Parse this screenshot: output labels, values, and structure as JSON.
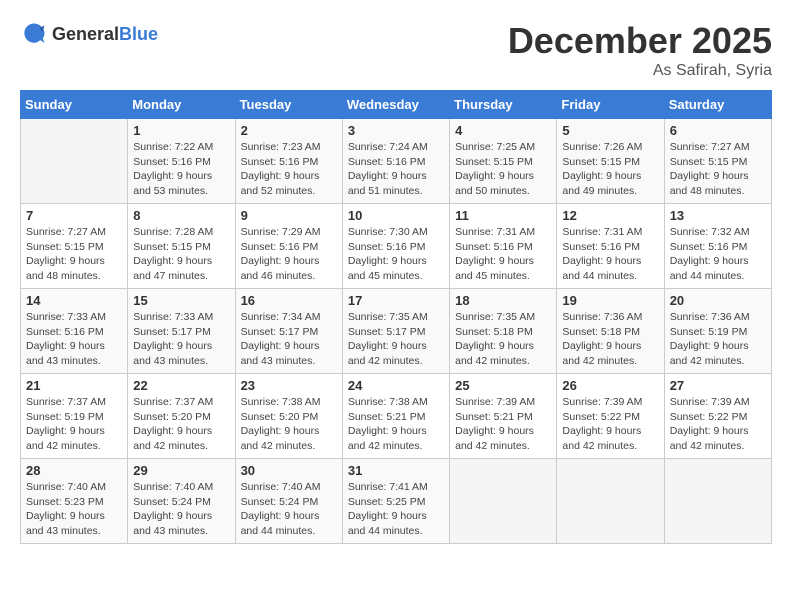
{
  "header": {
    "logo_general": "General",
    "logo_blue": "Blue",
    "month_year": "December 2025",
    "location": "As Safirah, Syria"
  },
  "days_of_week": [
    "Sunday",
    "Monday",
    "Tuesday",
    "Wednesday",
    "Thursday",
    "Friday",
    "Saturday"
  ],
  "weeks": [
    [
      {
        "day": "",
        "sunrise": "",
        "sunset": "",
        "daylight": "",
        "empty": true
      },
      {
        "day": "1",
        "sunrise": "7:22 AM",
        "sunset": "5:16 PM",
        "daylight": "9 hours and 53 minutes."
      },
      {
        "day": "2",
        "sunrise": "7:23 AM",
        "sunset": "5:16 PM",
        "daylight": "9 hours and 52 minutes."
      },
      {
        "day": "3",
        "sunrise": "7:24 AM",
        "sunset": "5:16 PM",
        "daylight": "9 hours and 51 minutes."
      },
      {
        "day": "4",
        "sunrise": "7:25 AM",
        "sunset": "5:15 PM",
        "daylight": "9 hours and 50 minutes."
      },
      {
        "day": "5",
        "sunrise": "7:26 AM",
        "sunset": "5:15 PM",
        "daylight": "9 hours and 49 minutes."
      },
      {
        "day": "6",
        "sunrise": "7:27 AM",
        "sunset": "5:15 PM",
        "daylight": "9 hours and 48 minutes."
      }
    ],
    [
      {
        "day": "7",
        "sunrise": "7:27 AM",
        "sunset": "5:15 PM",
        "daylight": "9 hours and 48 minutes."
      },
      {
        "day": "8",
        "sunrise": "7:28 AM",
        "sunset": "5:15 PM",
        "daylight": "9 hours and 47 minutes."
      },
      {
        "day": "9",
        "sunrise": "7:29 AM",
        "sunset": "5:16 PM",
        "daylight": "9 hours and 46 minutes."
      },
      {
        "day": "10",
        "sunrise": "7:30 AM",
        "sunset": "5:16 PM",
        "daylight": "9 hours and 45 minutes."
      },
      {
        "day": "11",
        "sunrise": "7:31 AM",
        "sunset": "5:16 PM",
        "daylight": "9 hours and 45 minutes."
      },
      {
        "day": "12",
        "sunrise": "7:31 AM",
        "sunset": "5:16 PM",
        "daylight": "9 hours and 44 minutes."
      },
      {
        "day": "13",
        "sunrise": "7:32 AM",
        "sunset": "5:16 PM",
        "daylight": "9 hours and 44 minutes."
      }
    ],
    [
      {
        "day": "14",
        "sunrise": "7:33 AM",
        "sunset": "5:16 PM",
        "daylight": "9 hours and 43 minutes."
      },
      {
        "day": "15",
        "sunrise": "7:33 AM",
        "sunset": "5:17 PM",
        "daylight": "9 hours and 43 minutes."
      },
      {
        "day": "16",
        "sunrise": "7:34 AM",
        "sunset": "5:17 PM",
        "daylight": "9 hours and 43 minutes."
      },
      {
        "day": "17",
        "sunrise": "7:35 AM",
        "sunset": "5:17 PM",
        "daylight": "9 hours and 42 minutes."
      },
      {
        "day": "18",
        "sunrise": "7:35 AM",
        "sunset": "5:18 PM",
        "daylight": "9 hours and 42 minutes."
      },
      {
        "day": "19",
        "sunrise": "7:36 AM",
        "sunset": "5:18 PM",
        "daylight": "9 hours and 42 minutes."
      },
      {
        "day": "20",
        "sunrise": "7:36 AM",
        "sunset": "5:19 PM",
        "daylight": "9 hours and 42 minutes."
      }
    ],
    [
      {
        "day": "21",
        "sunrise": "7:37 AM",
        "sunset": "5:19 PM",
        "daylight": "9 hours and 42 minutes."
      },
      {
        "day": "22",
        "sunrise": "7:37 AM",
        "sunset": "5:20 PM",
        "daylight": "9 hours and 42 minutes."
      },
      {
        "day": "23",
        "sunrise": "7:38 AM",
        "sunset": "5:20 PM",
        "daylight": "9 hours and 42 minutes."
      },
      {
        "day": "24",
        "sunrise": "7:38 AM",
        "sunset": "5:21 PM",
        "daylight": "9 hours and 42 minutes."
      },
      {
        "day": "25",
        "sunrise": "7:39 AM",
        "sunset": "5:21 PM",
        "daylight": "9 hours and 42 minutes."
      },
      {
        "day": "26",
        "sunrise": "7:39 AM",
        "sunset": "5:22 PM",
        "daylight": "9 hours and 42 minutes."
      },
      {
        "day": "27",
        "sunrise": "7:39 AM",
        "sunset": "5:22 PM",
        "daylight": "9 hours and 42 minutes."
      }
    ],
    [
      {
        "day": "28",
        "sunrise": "7:40 AM",
        "sunset": "5:23 PM",
        "daylight": "9 hours and 43 minutes."
      },
      {
        "day": "29",
        "sunrise": "7:40 AM",
        "sunset": "5:24 PM",
        "daylight": "9 hours and 43 minutes."
      },
      {
        "day": "30",
        "sunrise": "7:40 AM",
        "sunset": "5:24 PM",
        "daylight": "9 hours and 44 minutes."
      },
      {
        "day": "31",
        "sunrise": "7:41 AM",
        "sunset": "5:25 PM",
        "daylight": "9 hours and 44 minutes."
      },
      {
        "day": "",
        "sunrise": "",
        "sunset": "",
        "daylight": "",
        "empty": true
      },
      {
        "day": "",
        "sunrise": "",
        "sunset": "",
        "daylight": "",
        "empty": true
      },
      {
        "day": "",
        "sunrise": "",
        "sunset": "",
        "daylight": "",
        "empty": true
      }
    ]
  ],
  "labels": {
    "sunrise_prefix": "Sunrise: ",
    "sunset_prefix": "Sunset: ",
    "daylight_prefix": "Daylight: "
  }
}
